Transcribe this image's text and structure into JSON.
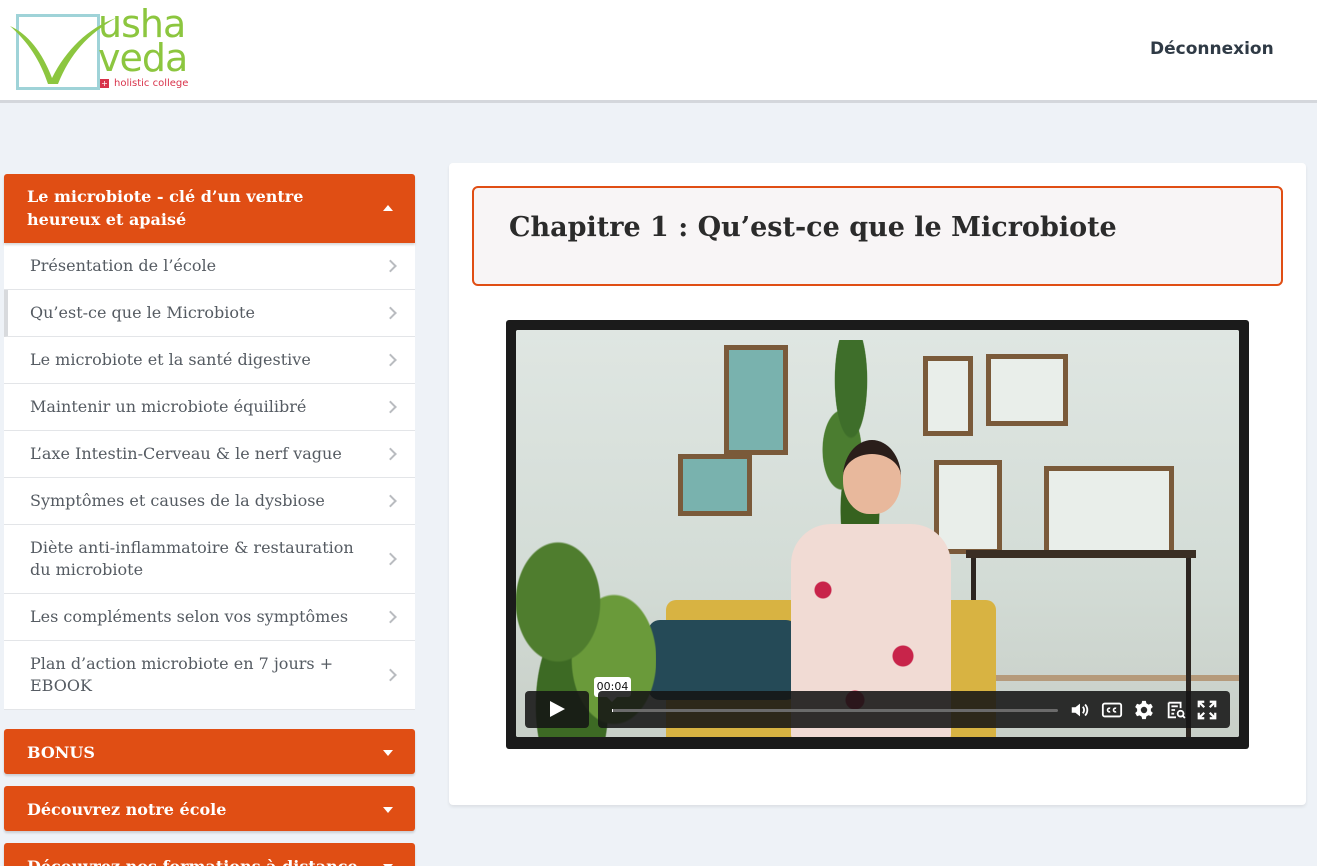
{
  "header": {
    "logo": {
      "word1": "usha",
      "word2": "veda",
      "subtitle": "holistic college",
      "cross": "+"
    },
    "logout_label": "Déconnexion"
  },
  "sidebar": {
    "modules": [
      {
        "title": "Le microbiote - clé d’un ventre heureux et apaisé",
        "open": true,
        "lessons": [
          "Présentation de l’école",
          "Qu’est-ce que le Microbiote",
          "Le microbiote et la santé digestive",
          "Maintenir un microbiote équilibré",
          "L’axe Intestin-Cerveau & le nerf vague",
          "Symptômes et causes de la dysbiose",
          "Diète anti-inflammatoire & restauration du microbiote",
          "Les compléments selon vos symptômes",
          "Plan d’action microbiote en 7 jours + EBOOK"
        ],
        "active_lesson_index": 1
      },
      {
        "title": "BONUS",
        "open": false
      },
      {
        "title": "Découvrez notre école",
        "open": false
      },
      {
        "title": "Découvrez nos formations à distance",
        "open": false
      }
    ],
    "accent_color": "#e04e14"
  },
  "main": {
    "chapter_title": "Chapitre 1 : Qu’est-ce que le Microbiote",
    "video": {
      "current_time": "00:04",
      "progress_fraction": 0.003,
      "controls": [
        "play-icon",
        "volume-icon",
        "closed-captions-icon",
        "settings-icon",
        "transcript-search-icon",
        "fullscreen-icon"
      ]
    }
  }
}
